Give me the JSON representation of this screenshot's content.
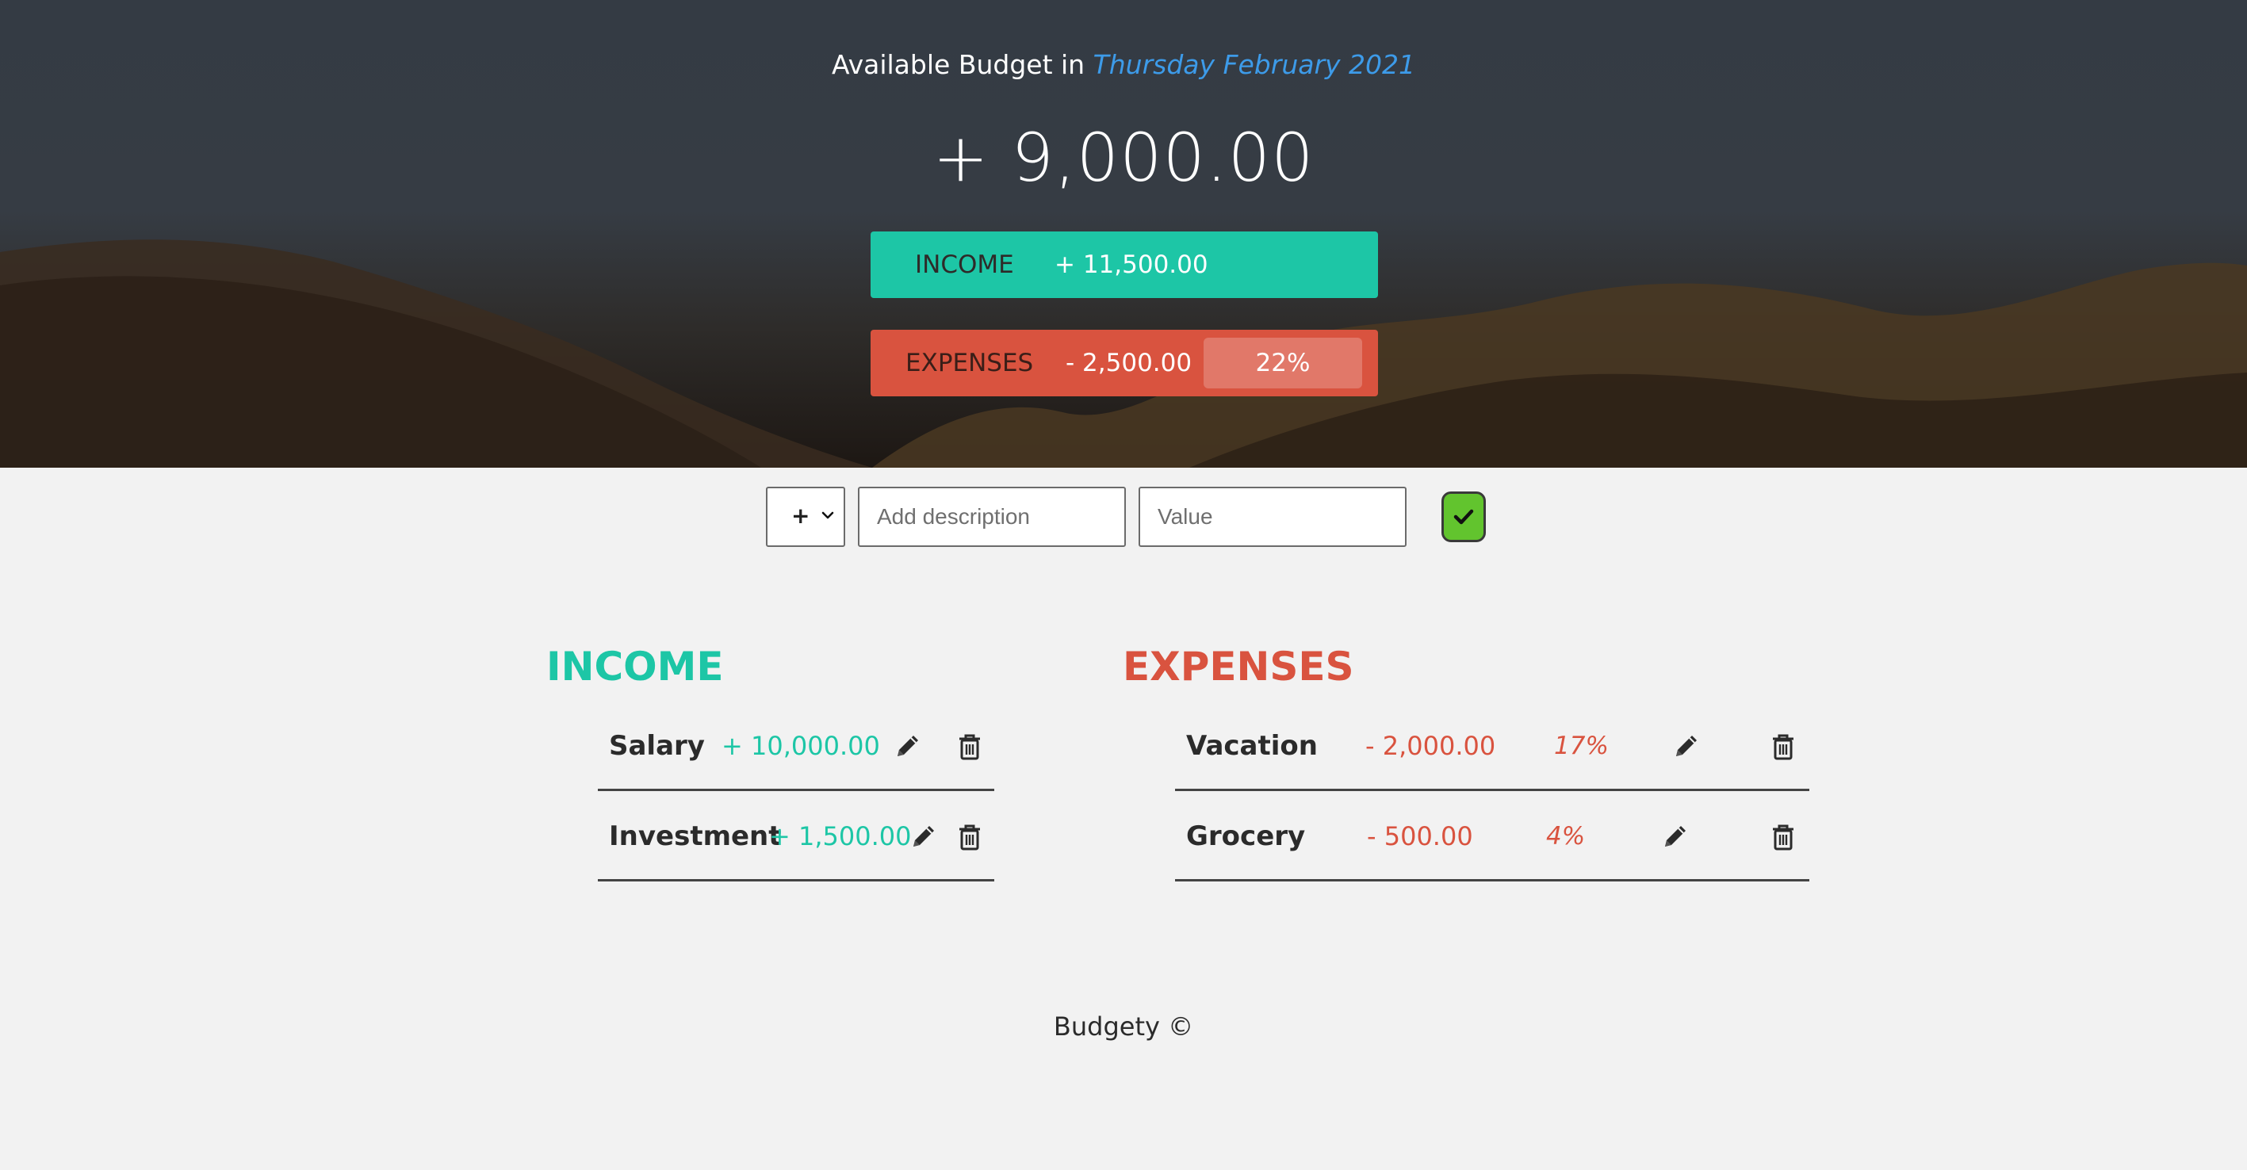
{
  "header": {
    "title_prefix": "Available Budget in",
    "month": "Thursday February 2021",
    "budget": "+ 9,000.00",
    "income": {
      "label": "INCOME",
      "value": "+ 11,500.00"
    },
    "expenses": {
      "label": "EXPENSES",
      "value": "- 2,500.00",
      "percentage": "22%"
    }
  },
  "add_form": {
    "type_value": "+",
    "description_placeholder": "Add description",
    "value_placeholder": "Value"
  },
  "income": {
    "title": "INCOME",
    "items": [
      {
        "description": "Salary",
        "value": "+ 10,000.00"
      },
      {
        "description": "Investment",
        "value": "+ 1,500.00"
      }
    ]
  },
  "expenses": {
    "title": "EXPENSES",
    "items": [
      {
        "description": "Vacation",
        "value": "- 2,000.00",
        "percentage": "17%"
      },
      {
        "description": "Grocery",
        "value": "- 500.00",
        "percentage": "4%"
      }
    ]
  },
  "icons": [
    "pencil-icon",
    "trash-icon",
    "check-icon",
    "chevron-down-icon"
  ],
  "colors": {
    "income": "#1dc6a6",
    "expenses": "#d9533f",
    "month": "#3d9be9",
    "add_button": "#62c42e"
  },
  "footer": {
    "text": "Budgety ©"
  }
}
